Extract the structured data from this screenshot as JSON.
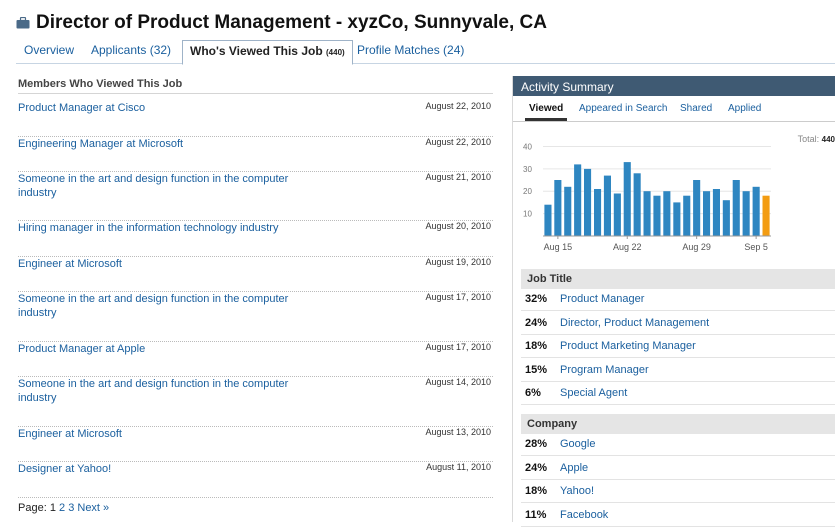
{
  "header": {
    "title": "Director of Product Management - xyzCo, Sunnyvale, CA",
    "icon": "briefcase-icon"
  },
  "tabs": [
    {
      "label": "Overview",
      "count": "",
      "active": false
    },
    {
      "label": "Applicants (32)",
      "count": "",
      "active": false
    },
    {
      "label": "Who's Viewed This Job",
      "count": "(440)",
      "active": true
    },
    {
      "label": "Profile Matches (24)",
      "count": "",
      "active": false
    }
  ],
  "viewers": {
    "heading": "Members Who Viewed This Job",
    "items": [
      {
        "name": "Product Manager at Cisco",
        "date": "August 22, 2010"
      },
      {
        "name": "Engineering Manager at Microsoft",
        "date": "August 22, 2010"
      },
      {
        "name": "Someone in the art and design function in the computer industry",
        "date": "August 21, 2010"
      },
      {
        "name": "Hiring manager in the information technology industry",
        "date": "August 20, 2010"
      },
      {
        "name": "Engineer at Microsoft",
        "date": "August 19, 2010"
      },
      {
        "name": "Someone in the art and design function in the computer industry",
        "date": "August 17, 2010"
      },
      {
        "name": "Product Manager at Apple",
        "date": "August 17, 2010"
      },
      {
        "name": "Someone in the art and design function in the computer industry",
        "date": "August 14, 2010"
      },
      {
        "name": "Engineer at Microsoft",
        "date": "August 13, 2010"
      },
      {
        "name": "Designer at Yahoo!",
        "date": "August 11, 2010"
      }
    ]
  },
  "pager": {
    "label": "Page:",
    "pages": [
      "1",
      "2",
      "3"
    ],
    "current": "1",
    "next": "Next »"
  },
  "activity": {
    "title": "Activity Summary",
    "subtabs": [
      {
        "label": "Viewed",
        "active": true
      },
      {
        "label": "Appeared in Search",
        "active": false
      },
      {
        "label": "Shared",
        "active": false
      },
      {
        "label": "Applied",
        "active": false
      }
    ],
    "total_label": "Total:",
    "total_value": "440"
  },
  "chart_data": {
    "type": "bar",
    "values": [
      14,
      25,
      22,
      32,
      30,
      21,
      27,
      19,
      33,
      28,
      20,
      18,
      20,
      15,
      18,
      25,
      20,
      21,
      16,
      25,
      20,
      22,
      18
    ],
    "x_tick_labels": [
      "Aug 15",
      "Aug 22",
      "Aug 29",
      "Sep 5"
    ],
    "x_tick_indices": [
      1,
      8,
      15,
      21
    ],
    "yticks": [
      10,
      20,
      30,
      40
    ],
    "ylim": [
      0,
      42
    ],
    "highlight_last": true,
    "colors": {
      "bar": "#2e86c1",
      "highlight": "#f39c12",
      "grid": "#e6e6e6"
    },
    "grid": true
  },
  "job_title": {
    "heading": "Job Title",
    "rows": [
      {
        "pct": "32%",
        "label": "Product Manager"
      },
      {
        "pct": "24%",
        "label": "Director, Product Management"
      },
      {
        "pct": "18%",
        "label": "Product Marketing Manager"
      },
      {
        "pct": "15%",
        "label": "Program Manager"
      },
      {
        "pct": "6%",
        "label": "Special Agent"
      }
    ]
  },
  "company": {
    "heading": "Company",
    "rows": [
      {
        "pct": "28%",
        "label": "Google"
      },
      {
        "pct": "24%",
        "label": "Apple"
      },
      {
        "pct": "18%",
        "label": "Yahoo!"
      },
      {
        "pct": "11%",
        "label": "Facebook"
      }
    ]
  }
}
